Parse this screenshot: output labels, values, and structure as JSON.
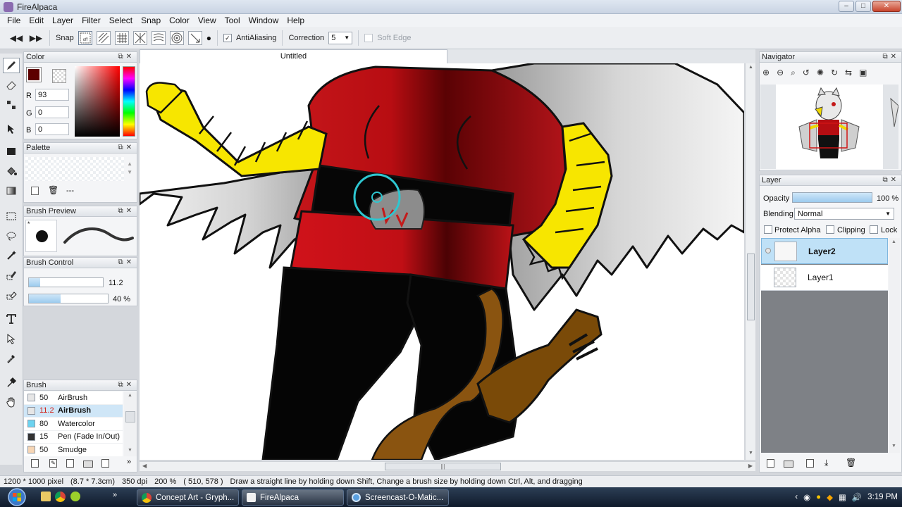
{
  "app": {
    "title": "FireAlpaca"
  },
  "menu": [
    "File",
    "Edit",
    "Layer",
    "Filter",
    "Select",
    "Snap",
    "Color",
    "View",
    "Tool",
    "Window",
    "Help"
  ],
  "toolbar": {
    "snap_label": "Snap",
    "snap_off_label": "off",
    "antialiasing_label": "AntiAliasing",
    "antialiasing_checked": true,
    "correction_label": "Correction",
    "correction_value": "5",
    "soft_edge_label": "Soft Edge"
  },
  "panels": {
    "color": {
      "title": "Color",
      "r_label": "R",
      "r_value": "93",
      "g_label": "G",
      "g_value": "0",
      "b_label": "B",
      "b_value": "0",
      "primary_color": "#5d0000"
    },
    "palette": {
      "title": "Palette",
      "dash": "---"
    },
    "brush_preview": {
      "title": "Brush Preview"
    },
    "brush_control": {
      "title": "Brush Control",
      "size_value": "11.2",
      "size_fraction": 0.15,
      "opacity_value": "40 %",
      "opacity_fraction": 0.4
    },
    "brush": {
      "title": "Brush",
      "items": [
        {
          "size": "50",
          "name": "AirBrush",
          "color": "#e6e6e6",
          "selected": false
        },
        {
          "size": "11.2",
          "name": "AirBrush",
          "color": "#e6e6e6",
          "selected": true
        },
        {
          "size": "80",
          "name": "Watercolor",
          "color": "#6cd3f0",
          "selected": false
        },
        {
          "size": "15",
          "name": "Pen (Fade In/Out)",
          "color": "#333333",
          "selected": false
        },
        {
          "size": "50",
          "name": "Smudge",
          "color": "#f7d6b5",
          "selected": false
        }
      ]
    },
    "navigator": {
      "title": "Navigator"
    },
    "layer": {
      "title": "Layer",
      "opacity_label": "Opacity",
      "opacity_value": "100 %",
      "blending_label": "Blending",
      "blending_value": "Normal",
      "protect_alpha_label": "Protect Alpha",
      "clipping_label": "Clipping",
      "lock_label": "Lock",
      "layers": [
        {
          "name": "Layer2",
          "selected": true
        },
        {
          "name": "Layer1",
          "selected": false
        }
      ]
    }
  },
  "canvas": {
    "tab_title": "Untitled"
  },
  "status": {
    "size": "1200 * 1000 pixel",
    "physical": "(8.7 * 7.3cm)",
    "dpi": "350 dpi",
    "zoom": "200 %",
    "coords": "( 510, 578 )",
    "hint": "Draw a straight line by holding down Shift, Change a brush size by holding down Ctrl, Alt, and dragging"
  },
  "taskbar": {
    "tasks": [
      {
        "label": "Concept Art - Gryph..."
      },
      {
        "label": "FireAlpaca"
      },
      {
        "label": "Screencast-O-Matic..."
      }
    ],
    "clock": "3:19 PM"
  }
}
